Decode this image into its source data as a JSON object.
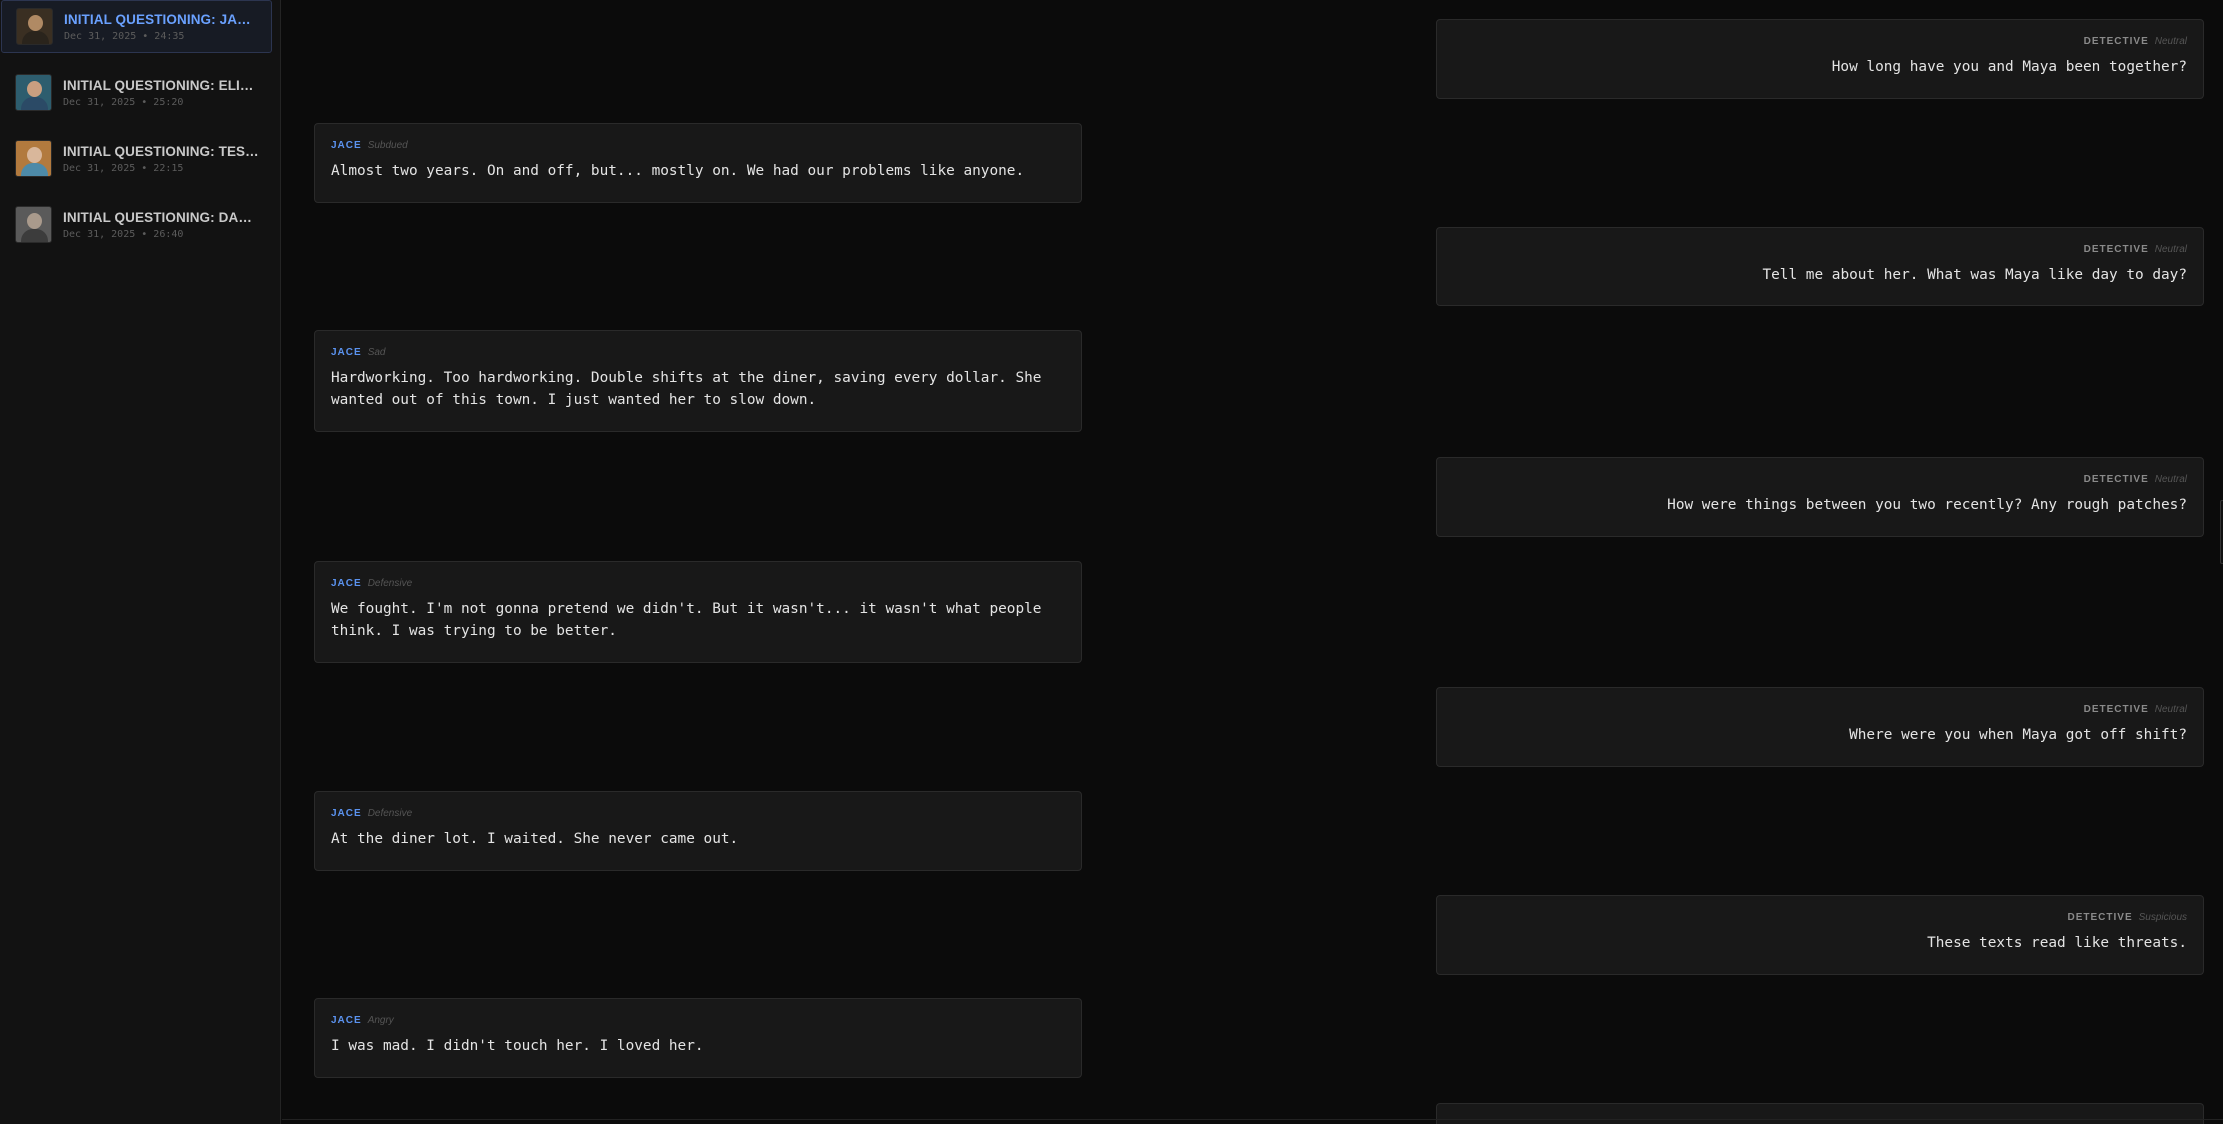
{
  "sessions": [
    {
      "title": "INITIAL QUESTIONING: JACE M...",
      "meta": "Dec 31, 2025 • 24:35",
      "active": true
    },
    {
      "title": "INITIAL QUESTIONING: ELIAS R...",
      "meta": "Dec 31, 2025 • 25:20",
      "active": false
    },
    {
      "title": "INITIAL QUESTIONING: TESSA ...",
      "meta": "Dec 31, 2025 • 22:15",
      "active": false
    },
    {
      "title": "INITIAL QUESTIONING: DALE W...",
      "meta": "Dec 31, 2025 • 26:40",
      "active": false
    }
  ],
  "messages": [
    {
      "speaker": "DETECTIVE",
      "mood": "Neutral",
      "text": "How long have you and Maya been together?"
    },
    {
      "speaker": "JACE",
      "mood": "Subdued",
      "text": "Almost two years. On and off, but... mostly on. We had our problems like anyone."
    },
    {
      "speaker": "DETECTIVE",
      "mood": "Neutral",
      "text": "Tell me about her. What was Maya like day to day?"
    },
    {
      "speaker": "JACE",
      "mood": "Sad",
      "text": "Hardworking. Too hardworking. Double shifts at the diner, saving every dollar. She\nwanted out of this town. I just wanted her to slow down."
    },
    {
      "speaker": "DETECTIVE",
      "mood": "Neutral",
      "text": "How were things between you two recently? Any rough patches?"
    },
    {
      "speaker": "JACE",
      "mood": "Defensive",
      "text": "We fought. I'm not gonna pretend we didn't. But it wasn't... it wasn't what people\nthink. I was trying to be better."
    },
    {
      "speaker": "DETECTIVE",
      "mood": "Neutral",
      "text": "Where were you when Maya got off shift?"
    },
    {
      "speaker": "JACE",
      "mood": "Defensive",
      "text": "At the diner lot. I waited. She never came out."
    },
    {
      "speaker": "DETECTIVE",
      "mood": "Suspicious",
      "text": "These texts read like threats."
    },
    {
      "speaker": "JACE",
      "mood": "Angry",
      "text": "I was mad. I didn't touch her. I loved her."
    }
  ],
  "colors": {
    "accent": "#5b93f0",
    "background": "#0b0b0b",
    "bubble": "#181818"
  }
}
